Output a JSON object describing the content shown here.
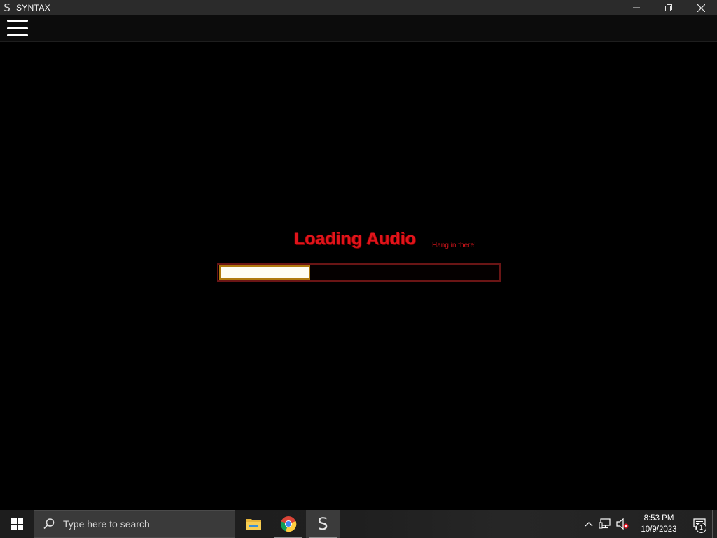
{
  "window": {
    "logo": "S",
    "title": "SYNTAX",
    "minimize_icon": "minimize-icon",
    "restore_icon": "restore-icon",
    "close_icon": "close-icon"
  },
  "header": {
    "menu_icon": "hamburger-menu-icon"
  },
  "loading": {
    "title": "Loading Audio",
    "subtitle": "Hang in there!",
    "progress": 0.32,
    "title_color": "#e0141b",
    "fill_color": "#fffdf3",
    "fill_border_color": "#b07a0e",
    "track_border_color": "#6a1515"
  },
  "taskbar": {
    "start_icon": "windows-start-icon",
    "search_placeholder": "Type here to search",
    "apps": [
      {
        "name": "File Explorer",
        "icon": "folder-icon"
      },
      {
        "name": "Google Chrome",
        "icon": "chrome-icon"
      },
      {
        "name": "SYNTAX",
        "icon": "syntax-app-icon",
        "glyph": "S",
        "active": true
      }
    ],
    "tray": {
      "time": "8:53 PM",
      "date": "10/9/2023",
      "notification_count": "1"
    }
  }
}
